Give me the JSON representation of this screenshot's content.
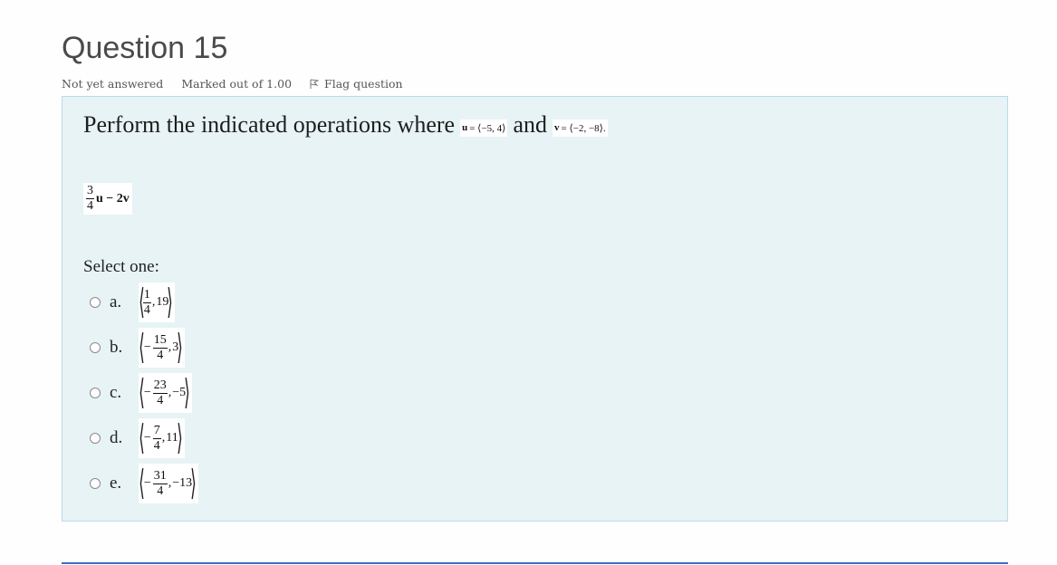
{
  "question": {
    "title": "Question 15",
    "status": "Not yet answered",
    "marks": "Marked out of 1.00",
    "flag_label": "Flag question",
    "flag_icon": "flag-icon",
    "prompt_text": "Perform the indicated operations where",
    "u_label": "u",
    "u_value": "= ⟨−5, 4⟩",
    "and_text": "and",
    "v_label": "v",
    "v_value": "= ⟨−2, −8⟩.",
    "expression": {
      "frac_num": "3",
      "frac_den": "4",
      "rest": "u − 2v"
    },
    "select_label": "Select one:",
    "options": [
      {
        "letter": "a.",
        "sign": "",
        "num": "1",
        "den": "4",
        "second": "19"
      },
      {
        "letter": "b.",
        "sign": "−",
        "num": "15",
        "den": "4",
        "second": "3"
      },
      {
        "letter": "c.",
        "sign": "−",
        "num": "23",
        "den": "4",
        "second": "−5"
      },
      {
        "letter": "d.",
        "sign": "−",
        "num": "7",
        "den": "4",
        "second": "11"
      },
      {
        "letter": "e.",
        "sign": "−",
        "num": "31",
        "den": "4",
        "second": "−13"
      }
    ]
  },
  "colors": {
    "question_bg": "#e7f3f5",
    "question_border": "#b8dce8",
    "footer_line": "#3a6fc4"
  }
}
